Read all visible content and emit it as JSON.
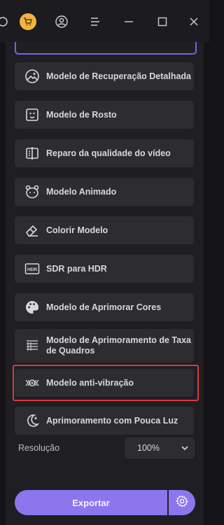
{
  "window": {
    "icons": [
      "app-icon",
      "cart-icon",
      "user-icon",
      "menu-icon",
      "minimize-icon",
      "maximize-icon",
      "close-icon"
    ]
  },
  "models": [
    {
      "label": "Modelo de Recuperação Detalhada",
      "icon": "landscape-icon"
    },
    {
      "label": "Modelo de Rosto",
      "icon": "face-icon"
    },
    {
      "label": "Reparo da qualidade do vídeo",
      "icon": "video-repair-icon"
    },
    {
      "label": "Modelo Animado",
      "icon": "animal-face-icon"
    },
    {
      "label": "Colorir Modelo",
      "icon": "eraser-icon"
    },
    {
      "label": "SDR para HDR",
      "icon": "hdr-icon"
    },
    {
      "label": "Modelo de Aprimorar Cores",
      "icon": "palette-icon"
    },
    {
      "label": "Modelo de Aprimoramento de Taxa de Quadros",
      "icon": "frames-icon"
    },
    {
      "label": "Modelo anti-vibração",
      "icon": "stabilize-icon",
      "highlighted": true
    },
    {
      "label": "Aprimoramento com Pouca Luz",
      "icon": "moon-icon"
    }
  ],
  "resolution": {
    "label": "Resolução",
    "value": "100%"
  },
  "export": {
    "label": "Exportar"
  },
  "colors": {
    "accent": "#8c76ee",
    "highlight": "#e0353a",
    "cart": "#f3b43f"
  }
}
